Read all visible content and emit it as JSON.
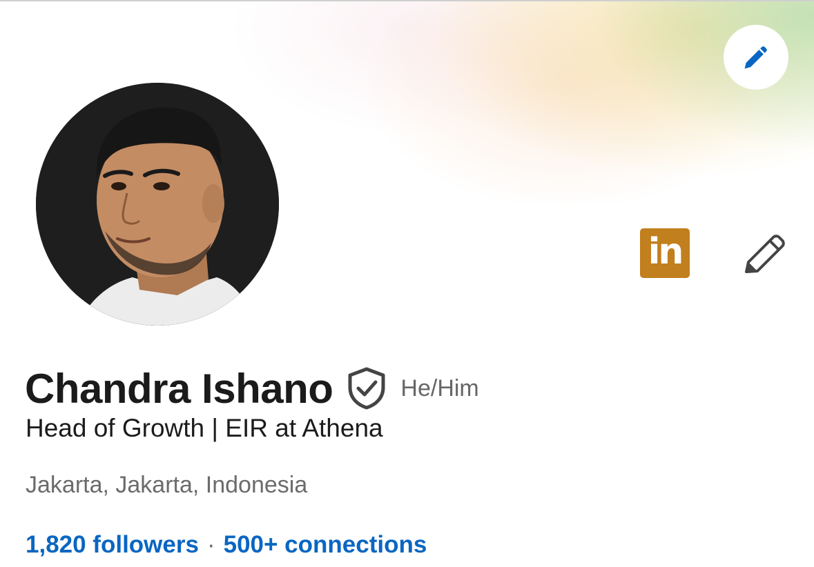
{
  "profile": {
    "name": "Chandra Ishano",
    "pronouns": "He/Him",
    "headline": "Head of Growth | EIR at Athena",
    "location": "Jakarta, Jakarta, Indonesia",
    "followers": "1,820 followers",
    "separator": "·",
    "connections": "500+ connections"
  },
  "linkedin_badge": {
    "text": "in",
    "color": "#c27f1d"
  },
  "icons": {
    "banner_edit": "pencil-icon",
    "intro_edit": "pencil-icon",
    "verified": "shield-check-icon"
  },
  "colors": {
    "link": "#0a66c2",
    "banner_edit_pencil": "#0a66c2",
    "text_primary": "#1b1b1b",
    "text_secondary": "#666666"
  }
}
